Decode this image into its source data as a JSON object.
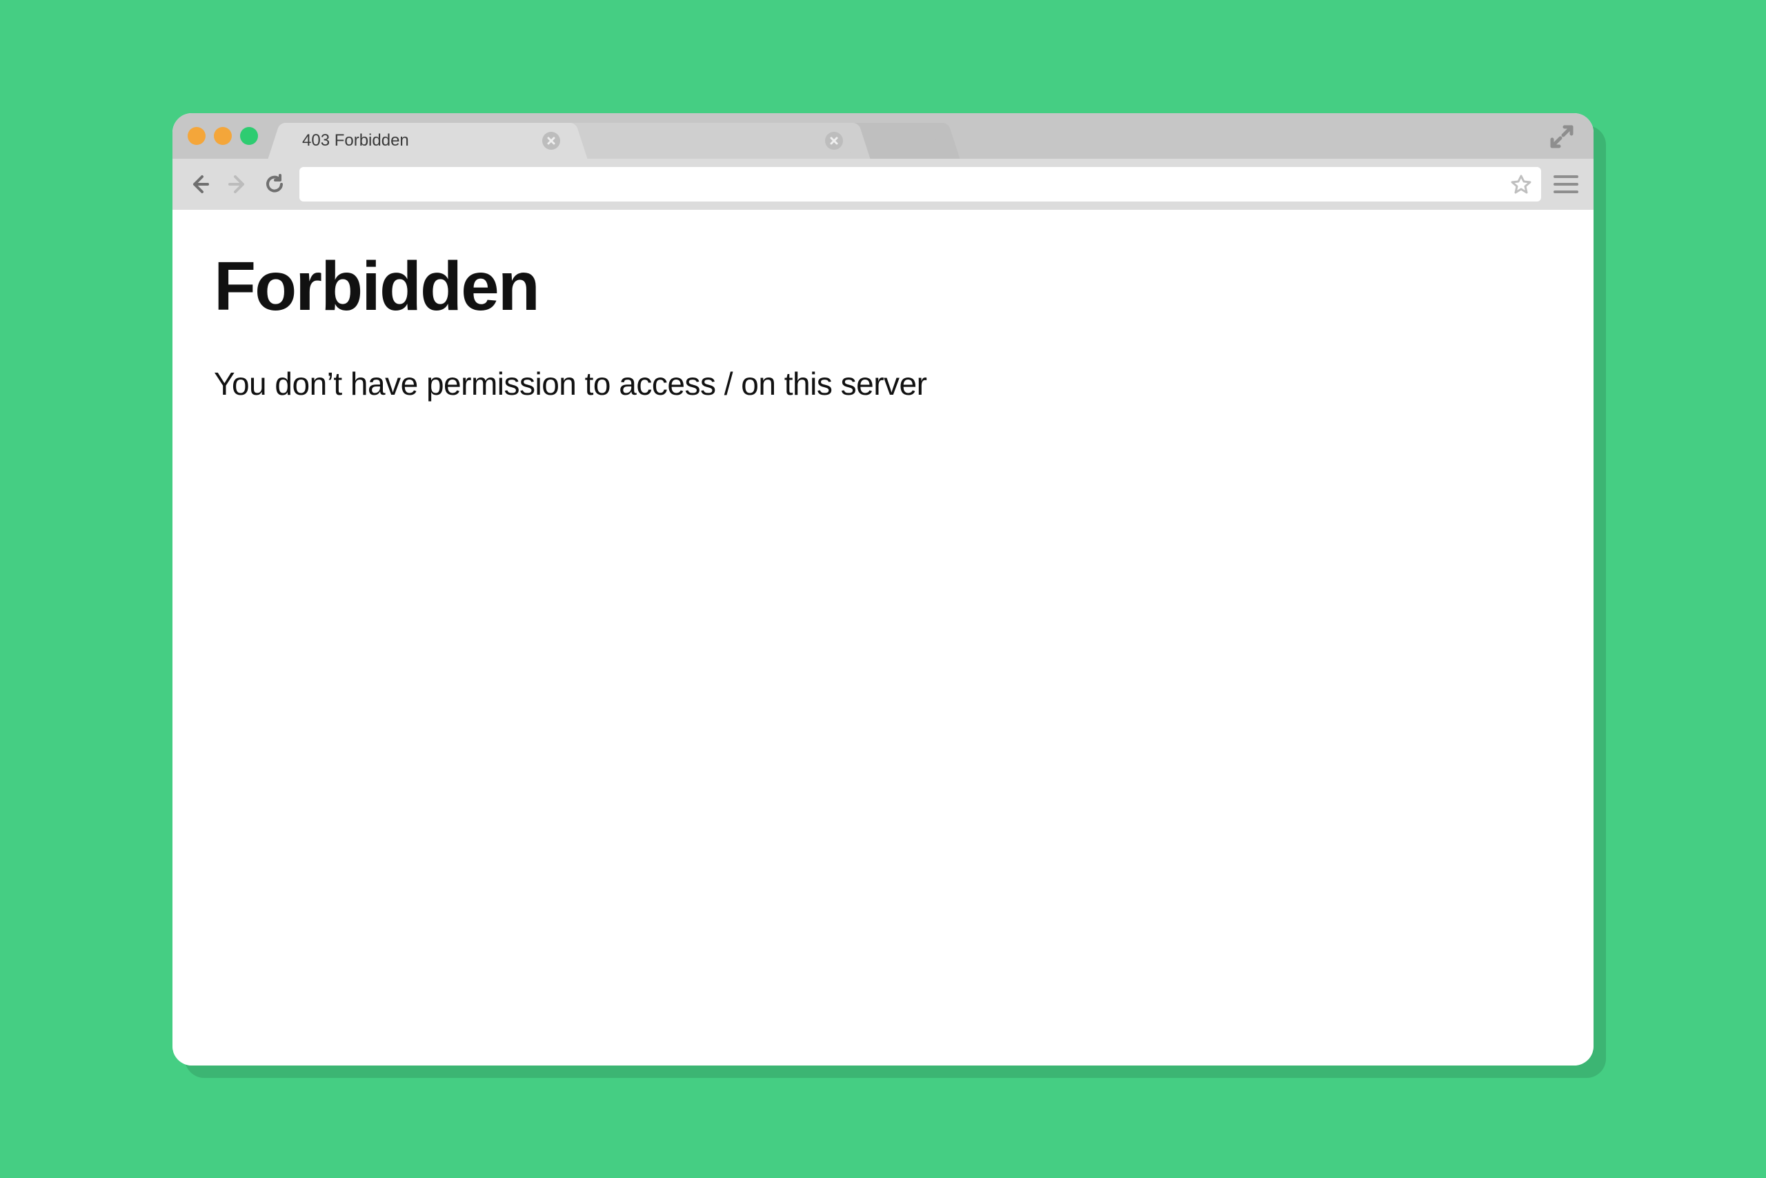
{
  "window": {
    "tabs": [
      {
        "title": "403 Forbidden",
        "active": true
      },
      {
        "title": "",
        "active": false
      }
    ]
  },
  "toolbar": {
    "address_value": ""
  },
  "page": {
    "heading": "Forbidden",
    "message": "You don’t have permission to access / on this server"
  }
}
